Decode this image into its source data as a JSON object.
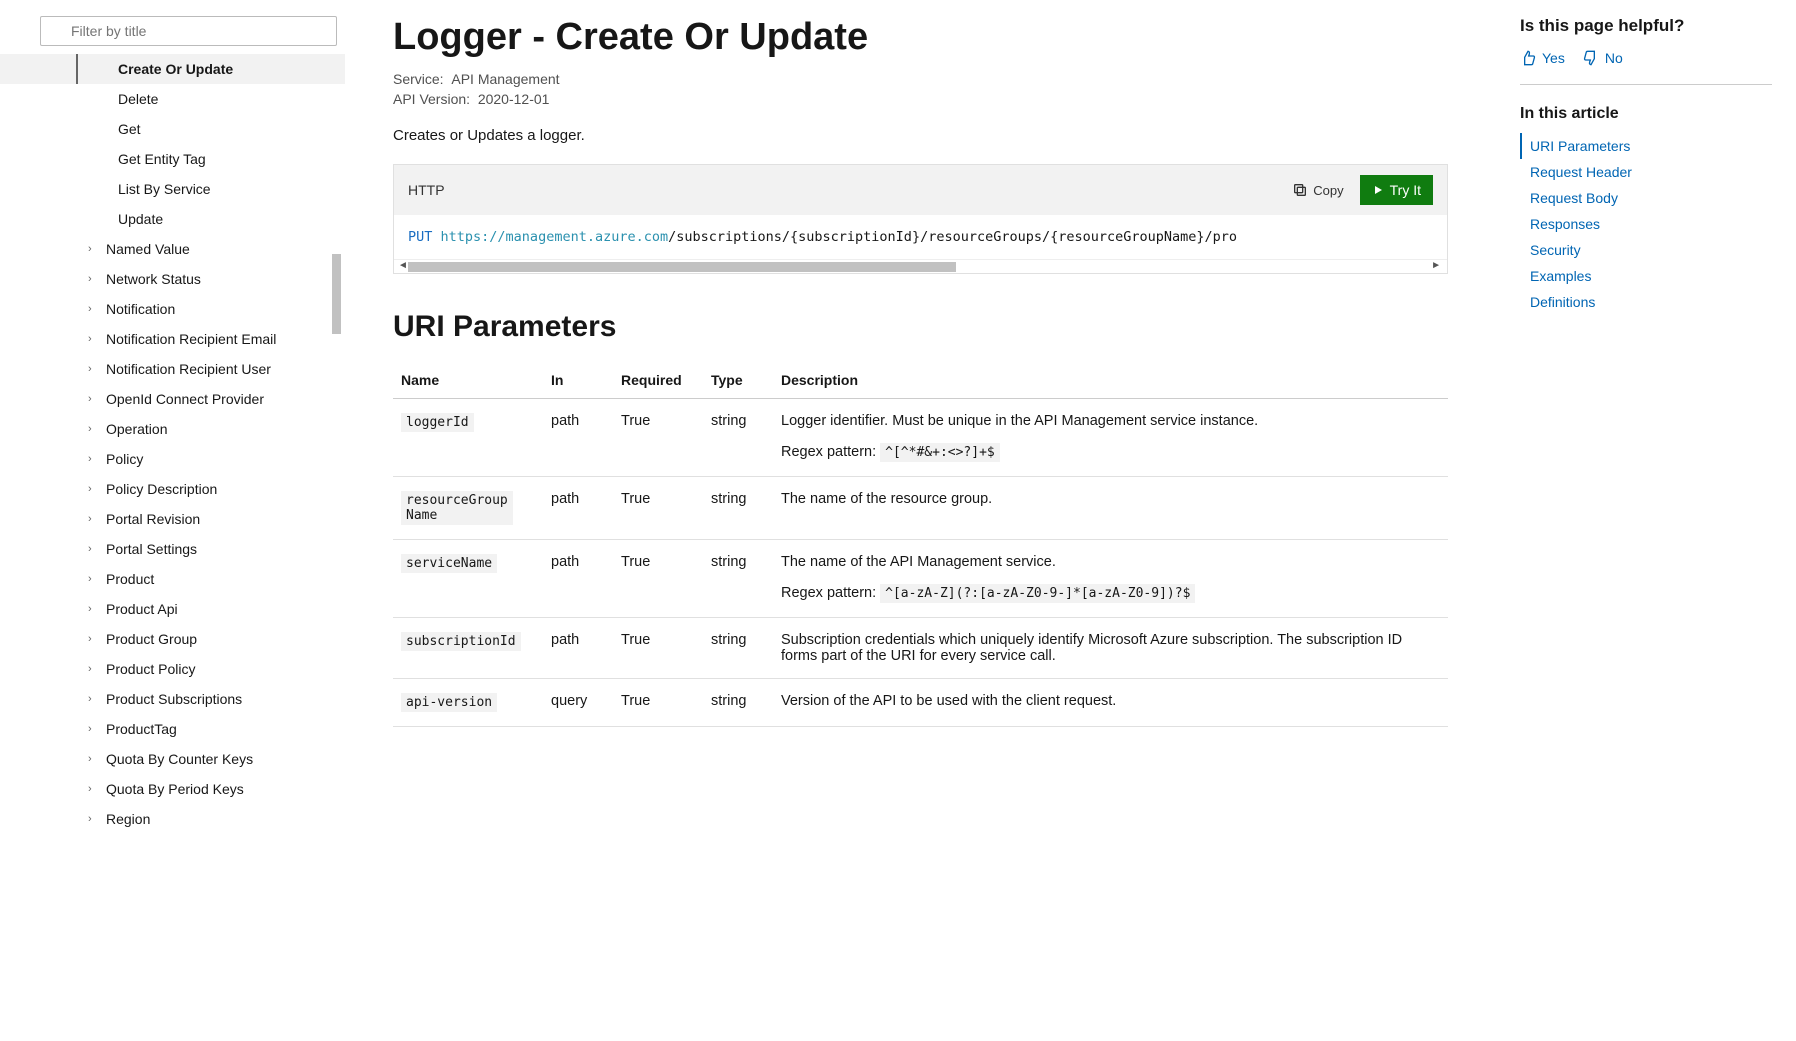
{
  "filter": {
    "placeholder": "Filter by title"
  },
  "nav": {
    "logger_children": [
      "Create Or Update",
      "Delete",
      "Get",
      "Get Entity Tag",
      "List By Service",
      "Update"
    ],
    "siblings": [
      "Named Value",
      "Network Status",
      "Notification",
      "Notification Recipient Email",
      "Notification Recipient User",
      "OpenId Connect Provider",
      "Operation",
      "Policy",
      "Policy Description",
      "Portal Revision",
      "Portal Settings",
      "Product",
      "Product Api",
      "Product Group",
      "Product Policy",
      "Product Subscriptions",
      "ProductTag",
      "Quota By Counter Keys",
      "Quota By Period Keys",
      "Region"
    ]
  },
  "page": {
    "title": "Logger - Create Or Update",
    "service_label": "Service:",
    "service": "API Management",
    "apiver_label": "API Version:",
    "apiver": "2020-12-01",
    "description": "Creates or Updates a logger."
  },
  "code": {
    "lang": "HTTP",
    "copy_label": "Copy",
    "tryit_label": "Try It",
    "verb": "PUT",
    "url_base": "https://management.azure.com",
    "url_rest": "/subscriptions/{subscriptionId}/resourceGroups/{resourceGroupName}/pro"
  },
  "uri_section": {
    "heading": "URI Parameters",
    "cols": {
      "name": "Name",
      "in": "In",
      "required": "Required",
      "type": "Type",
      "description": "Description"
    },
    "rows": [
      {
        "name": "loggerId",
        "in": "path",
        "required": "True",
        "type": "string",
        "desc": "Logger identifier. Must be unique in the API Management service instance.",
        "regex_label": "Regex pattern:",
        "regex": "^[^*#&+:<>?]+$"
      },
      {
        "name": "resourceGroupName",
        "in": "path",
        "required": "True",
        "type": "string",
        "desc": "The name of the resource group."
      },
      {
        "name": "serviceName",
        "in": "path",
        "required": "True",
        "type": "string",
        "desc": "The name of the API Management service.",
        "regex_label": "Regex pattern:",
        "regex": "^[a-zA-Z](?:[a-zA-Z0-9-]*[a-zA-Z0-9])?$"
      },
      {
        "name": "subscriptionId",
        "in": "path",
        "required": "True",
        "type": "string",
        "desc": "Subscription credentials which uniquely identify Microsoft Azure subscription. The subscription ID forms part of the URI for every service call."
      },
      {
        "name": "api-version",
        "in": "query",
        "required": "True",
        "type": "string",
        "desc": "Version of the API to be used with the client request."
      }
    ]
  },
  "right": {
    "helpful": "Is this page helpful?",
    "yes": "Yes",
    "no": "No",
    "in_article": "In this article",
    "toc": [
      "URI Parameters",
      "Request Header",
      "Request Body",
      "Responses",
      "Security",
      "Examples",
      "Definitions"
    ]
  }
}
